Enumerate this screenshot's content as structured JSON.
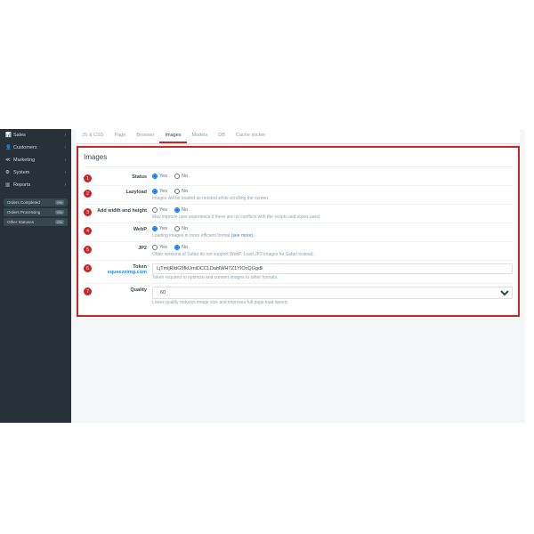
{
  "sidebar": {
    "items": [
      {
        "icon": "📊",
        "label": "Sales"
      },
      {
        "icon": "👤",
        "label": "Customers"
      },
      {
        "icon": "↗",
        "label": "Marketing"
      },
      {
        "icon": "⚙",
        "label": "System"
      },
      {
        "icon": "📈",
        "label": "Reports"
      }
    ],
    "statuses": [
      {
        "label": "Orders Completed",
        "pct": "0%"
      },
      {
        "label": "Orders Processing",
        "pct": "0%"
      },
      {
        "label": "Other Statuses",
        "pct": "0%"
      }
    ]
  },
  "tabs": [
    {
      "label": "JS & CSS"
    },
    {
      "label": "Page"
    },
    {
      "label": "Browser"
    },
    {
      "label": "Images",
      "active": true
    },
    {
      "label": "Models"
    },
    {
      "label": "DB"
    },
    {
      "label": "Cache sticker"
    }
  ],
  "panel": {
    "title": "Images",
    "yes": "Yes",
    "no": "No",
    "rows": [
      {
        "num": "1",
        "label": "Status",
        "type": "radio",
        "value": "yes",
        "help": ""
      },
      {
        "num": "2",
        "label": "Lazyload",
        "type": "radio",
        "value": "yes",
        "help": "Images will be loaded as needed while scrolling the screen."
      },
      {
        "num": "3",
        "label": "Add width and height",
        "type": "radio",
        "value": "no",
        "help": "May improve user experience if there are no conflicts with the scripts and styles used."
      },
      {
        "num": "4",
        "label": "WebP",
        "type": "radio",
        "value": "yes",
        "help": "Loading images in more efficient format ",
        "help_link": "(see more)"
      },
      {
        "num": "5",
        "label": "JP2",
        "type": "radio",
        "value": "no",
        "help": "Older versions of Safari do not support WebP. Load JP2 images for Safari instead."
      },
      {
        "num": "6",
        "label": "Token ",
        "label_link": "squeezeimg.com",
        "type": "text",
        "value": "LjTmljRIdG5fkUrniDCCLDahlWHTZ1YIOcQGgdli",
        "help": "Token required to optimize and convert images to other formats."
      },
      {
        "num": "7",
        "label": "Quality",
        "type": "select",
        "value": "60",
        "help": "Lower quality reduces image size and improves full page load speed."
      }
    ]
  }
}
